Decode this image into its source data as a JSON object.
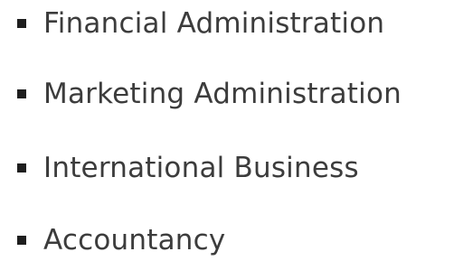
{
  "list": {
    "items": [
      "Financial Administration",
      "Marketing Administration",
      "International Business",
      "Accountancy"
    ]
  }
}
